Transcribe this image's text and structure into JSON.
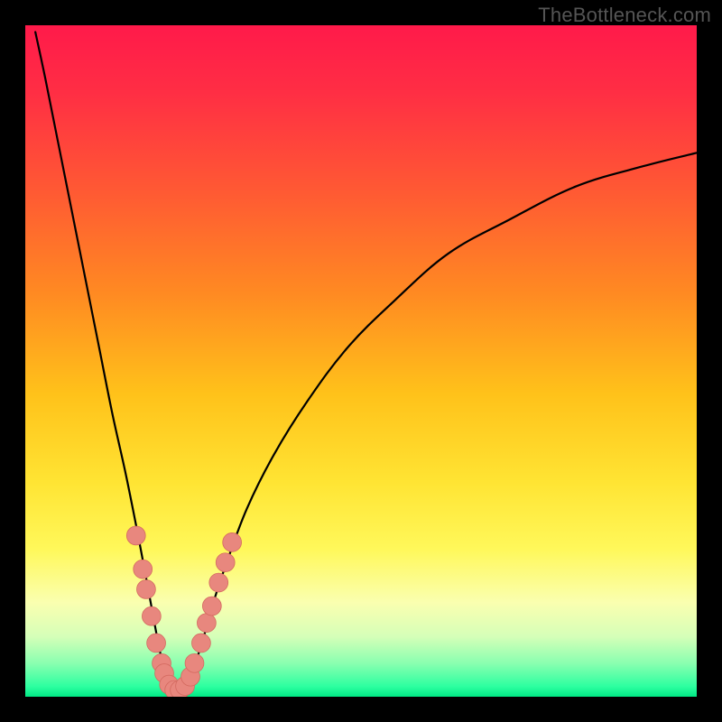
{
  "watermark": "TheBottleneck.com",
  "colors": {
    "frame": "#000000",
    "curve": "#000000",
    "marker_fill": "#e8877e",
    "marker_stroke": "#d46a60",
    "gradient_stops": [
      {
        "offset": 0.0,
        "color": "#ff1a4a"
      },
      {
        "offset": 0.1,
        "color": "#ff2e44"
      },
      {
        "offset": 0.25,
        "color": "#ff5a33"
      },
      {
        "offset": 0.4,
        "color": "#ff8a22"
      },
      {
        "offset": 0.55,
        "color": "#ffc21a"
      },
      {
        "offset": 0.68,
        "color": "#ffe433"
      },
      {
        "offset": 0.78,
        "color": "#fff85a"
      },
      {
        "offset": 0.86,
        "color": "#faffb0"
      },
      {
        "offset": 0.91,
        "color": "#d6ffb8"
      },
      {
        "offset": 0.95,
        "color": "#8affb0"
      },
      {
        "offset": 0.985,
        "color": "#2cffa0"
      },
      {
        "offset": 1.0,
        "color": "#00e884"
      }
    ]
  },
  "chart_data": {
    "type": "line",
    "title": "",
    "xlabel": "",
    "ylabel": "",
    "xlim": [
      0,
      100
    ],
    "ylim": [
      0,
      100
    ],
    "grid": false,
    "legend": false,
    "description": "V-shaped bottleneck curve. Vertical axis is percent bottleneck (0 at bottom, 100 at top). Curve minimum near x≈22 at y≈0; rises steeply to y≈100 at x≈0, and rises with diminishing slope toward y≈80 at x≈100.",
    "curve": [
      {
        "x": 1.5,
        "y": 99
      },
      {
        "x": 3,
        "y": 92
      },
      {
        "x": 5,
        "y": 82
      },
      {
        "x": 7,
        "y": 72
      },
      {
        "x": 9,
        "y": 62
      },
      {
        "x": 11,
        "y": 52
      },
      {
        "x": 13,
        "y": 42
      },
      {
        "x": 15,
        "y": 33
      },
      {
        "x": 17,
        "y": 23
      },
      {
        "x": 18.5,
        "y": 15
      },
      {
        "x": 20,
        "y": 7
      },
      {
        "x": 21,
        "y": 3
      },
      {
        "x": 22,
        "y": 0.5
      },
      {
        "x": 23,
        "y": 0.5
      },
      {
        "x": 24,
        "y": 2
      },
      {
        "x": 26,
        "y": 7
      },
      {
        "x": 28,
        "y": 14
      },
      {
        "x": 30,
        "y": 20
      },
      {
        "x": 33,
        "y": 28
      },
      {
        "x": 37,
        "y": 36
      },
      {
        "x": 42,
        "y": 44
      },
      {
        "x": 48,
        "y": 52
      },
      {
        "x": 55,
        "y": 59
      },
      {
        "x": 63,
        "y": 66
      },
      {
        "x": 72,
        "y": 71
      },
      {
        "x": 82,
        "y": 76
      },
      {
        "x": 92,
        "y": 79
      },
      {
        "x": 100,
        "y": 81
      }
    ],
    "markers": [
      {
        "x": 16.5,
        "y": 24
      },
      {
        "x": 17.5,
        "y": 19
      },
      {
        "x": 18.0,
        "y": 16
      },
      {
        "x": 18.8,
        "y": 12
      },
      {
        "x": 19.5,
        "y": 8
      },
      {
        "x": 20.3,
        "y": 5
      },
      {
        "x": 20.7,
        "y": 3.5
      },
      {
        "x": 21.4,
        "y": 1.8
      },
      {
        "x": 22.2,
        "y": 1.0
      },
      {
        "x": 23.0,
        "y": 1.0
      },
      {
        "x": 23.8,
        "y": 1.6
      },
      {
        "x": 24.6,
        "y": 3.0
      },
      {
        "x": 25.2,
        "y": 5.0
      },
      {
        "x": 26.2,
        "y": 8.0
      },
      {
        "x": 27.0,
        "y": 11.0
      },
      {
        "x": 27.8,
        "y": 13.5
      },
      {
        "x": 28.8,
        "y": 17.0
      },
      {
        "x": 29.8,
        "y": 20.0
      },
      {
        "x": 30.8,
        "y": 23.0
      }
    ],
    "marker_radius_data_units": 1.4
  }
}
